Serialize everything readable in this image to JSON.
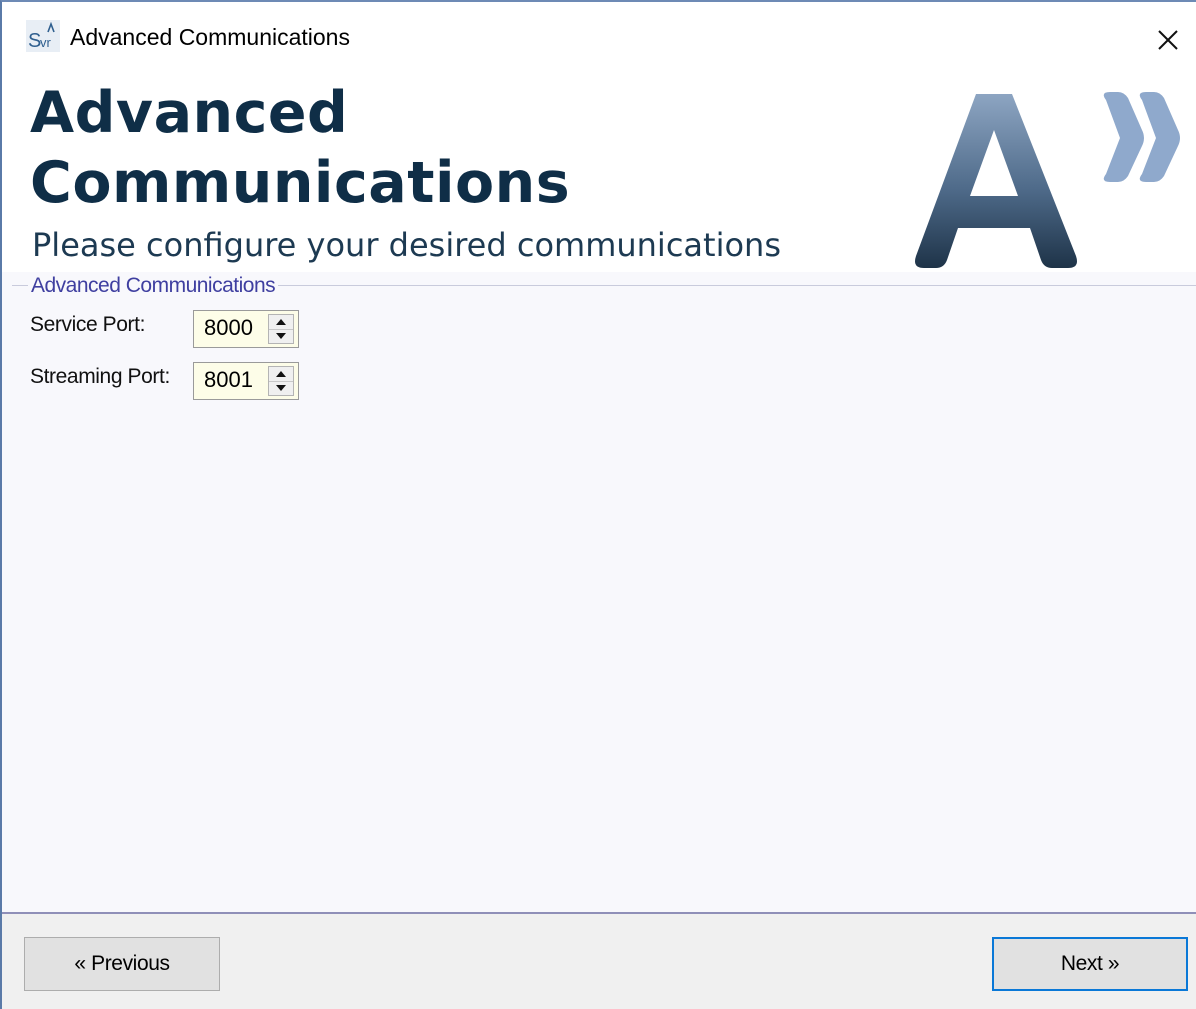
{
  "window": {
    "title": "Advanced Communications",
    "app_icon": "svr-app-icon",
    "close_icon": "close-icon"
  },
  "header": {
    "title_line1": "Advanced",
    "title_line2": "Communications",
    "subtitle": "Please configure your desired communications",
    "logo": "advanced-a-logo",
    "title_color": "#0f2e47"
  },
  "group": {
    "legend": "Advanced Communications",
    "legend_color": "#3f3fa0"
  },
  "fields": {
    "service_port": {
      "label": "Service Port:",
      "value": "8000"
    },
    "streaming_port": {
      "label": "Streaming Port:",
      "value": "8001"
    }
  },
  "footer": {
    "previous_label": "« Previous",
    "next_label": "Next »",
    "focus_color": "#0a78d7"
  }
}
